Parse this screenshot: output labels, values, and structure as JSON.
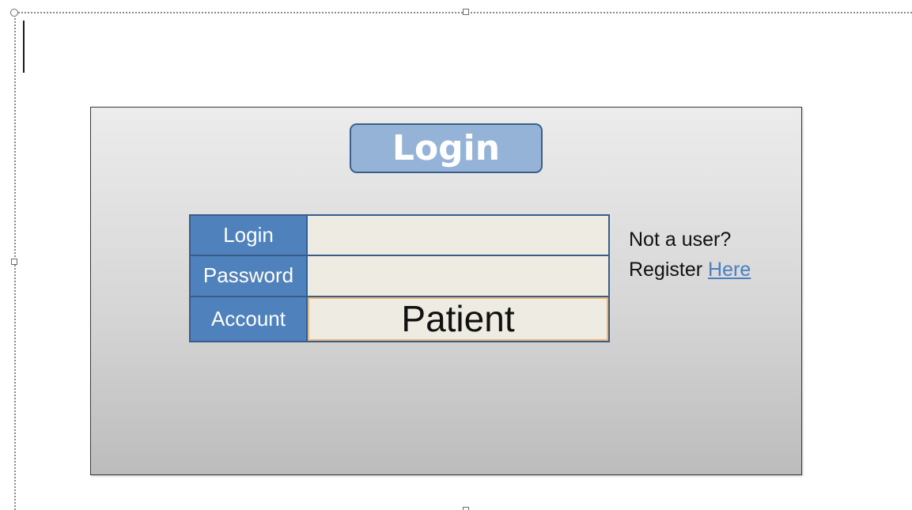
{
  "slide": {
    "title": "Login",
    "form": {
      "rows": [
        {
          "label": "Login",
          "value": ""
        },
        {
          "label": "Password",
          "value": ""
        },
        {
          "label": "Account",
          "value": "Patient"
        }
      ]
    },
    "register": {
      "line1": "Not a user?",
      "prefix": "Register ",
      "link_text": "Here"
    }
  },
  "colors": {
    "title_fill": "#95b3d7",
    "label_fill": "#4f81bd",
    "field_fill": "#eeebe2",
    "link": "#4a7fc1",
    "selection_outline": "#f0b873"
  }
}
